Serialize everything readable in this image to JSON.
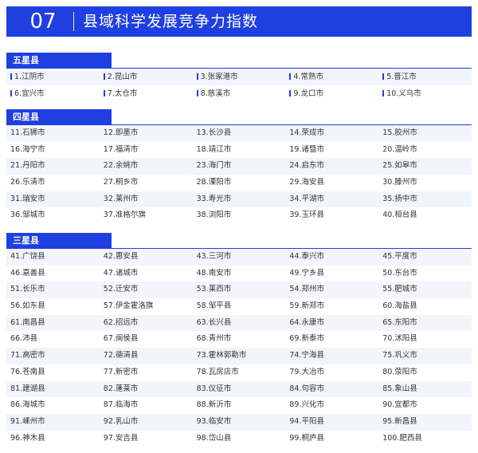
{
  "banner": {
    "number": "07",
    "title": "县域科学发展竞争力指数"
  },
  "sections": [
    {
      "title": "五星县",
      "bulleted": true,
      "items": [
        "1.江阴市",
        "2.昆山市",
        "3.张家港市",
        "4.常熟市",
        "5.晋江市",
        "6.宜兴市",
        "7.太仓市",
        "8.慈溪市",
        "9.龙口市",
        "10.义乌市"
      ]
    },
    {
      "title": "四星县",
      "bulleted": false,
      "items": [
        "11.石狮市",
        "12.即墨市",
        "13.长沙县",
        "14.荣成市",
        "15.胶州市",
        "16.海宁市",
        "17.福清市",
        "18.靖江市",
        "19.诸暨市",
        "20.温岭市",
        "21.丹阳市",
        "22.余姚市",
        "23.海门市",
        "24.启东市",
        "25.如皋市",
        "26.乐清市",
        "27.桐乡市",
        "28.溧阳市",
        "29.海安县",
        "30.滕州市",
        "31.瑞安市",
        "32.莱州市",
        "33.寿光市",
        "34.平湖市",
        "35.扬中市",
        "36.邹城市",
        "37.准格尔旗",
        "38.浏阳市",
        "39.玉环县",
        "40.桓台县"
      ]
    },
    {
      "title": "三星县",
      "bulleted": false,
      "items": [
        "41.广饶县",
        "42.惠安县",
        "43.三河市",
        "44.泰兴市",
        "45.平度市",
        "46.嘉善县",
        "47.诸城市",
        "48.南安市",
        "49.宁乡县",
        "50.东台市",
        "51.长乐市",
        "52.迁安市",
        "53.莱西市",
        "54.郑州市",
        "55.肥城市",
        "56.如东县",
        "57.伊金霍洛旗",
        "58.邹平县",
        "59.新郑市",
        "60.海盐县",
        "61.南昌县",
        "62.招远市",
        "63.长兴县",
        "64.永康市",
        "65.东阳市",
        "66.沛县",
        "67.闽侯县",
        "68.青州市",
        "69.新泰市",
        "70.沭阳县",
        "71.高密市",
        "72.德清县",
        "73.霍林郭勒市",
        "74.宁海县",
        "75.巩义市",
        "76.苍南县",
        "77.新密市",
        "78.瓦房店市",
        "79.大冶市",
        "80.荥阳市",
        "81.建湖县",
        "82.蓬莱市",
        "83.仪征市",
        "84.句容市",
        "85.象山县",
        "86.海城市",
        "87.临海市",
        "88.新沂市",
        "89.兴化市",
        "90.宜都市",
        "91.嵊州市",
        "92.乳山市",
        "93.临安市",
        "94.平阳县",
        "95.新昌县",
        "96.神木县",
        "97.安吉县",
        "98.岱山县",
        "99.桐庐县",
        "100.肥西县"
      ]
    }
  ]
}
